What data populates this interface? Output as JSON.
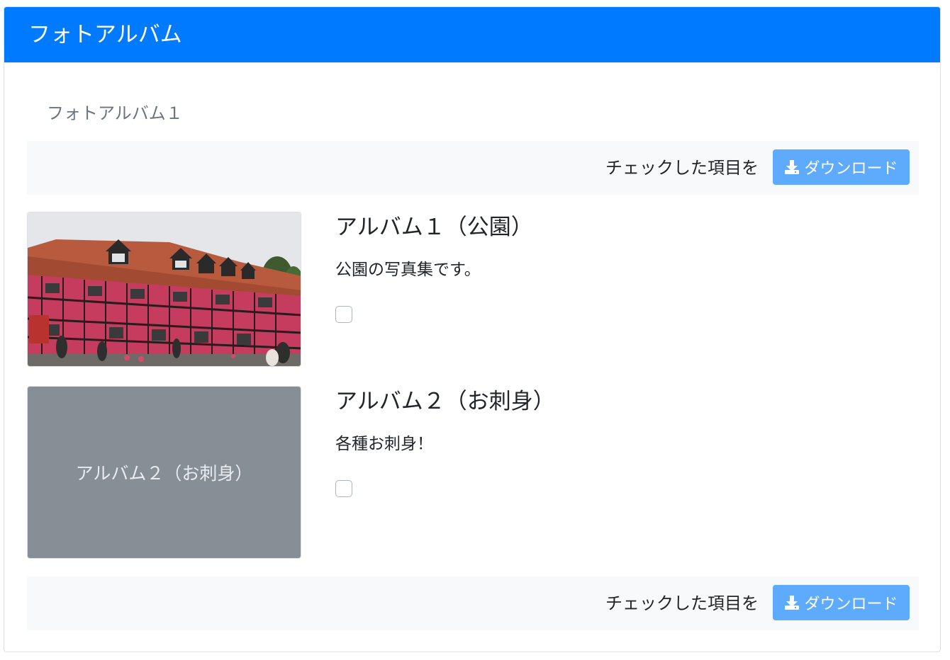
{
  "header": {
    "title": "フォトアルバム"
  },
  "section": {
    "title": "フォトアルバム１"
  },
  "toolbar": {
    "label": "チェックした項目を",
    "download_label": "ダウンロード",
    "download_icon": "download-icon"
  },
  "albums": [
    {
      "title": "アルバム１（公園）",
      "description": "公園の写真集です。",
      "thumbnail": "photo of half-timbered pink building",
      "checked": false
    },
    {
      "title": "アルバム２（お刺身）",
      "description": "各種お刺身！",
      "thumbnail_placeholder": "アルバム２（お刺身）",
      "checked": false
    }
  ],
  "colors": {
    "header_bg": "#007bff",
    "button_bg": "#5eabfd",
    "toolbar_bg": "#f8f9fa",
    "placeholder_bg": "#868e96"
  }
}
